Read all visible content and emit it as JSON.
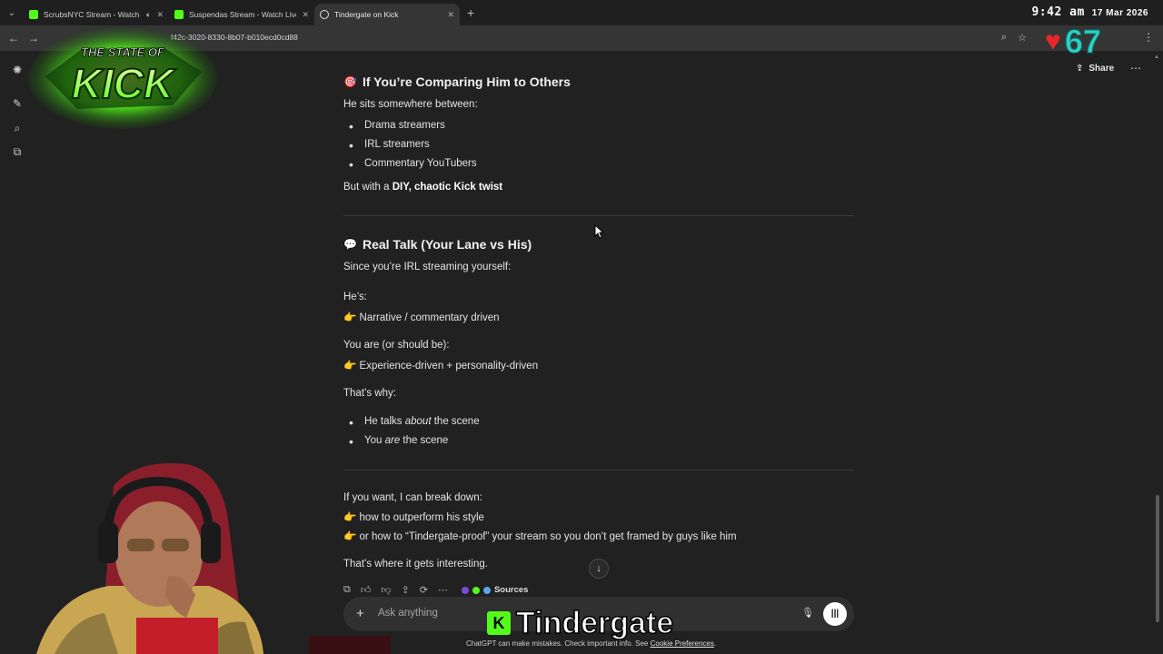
{
  "browser": {
    "tabs": [
      {
        "title": "ScrubsNYC Stream - Watch",
        "icon": "kick-icon"
      },
      {
        "title": "Suspendas Stream - Watch Live",
        "icon": "kick-icon"
      },
      {
        "title": "Tindergate on Kick",
        "icon": "chatgpt-icon"
      }
    ],
    "url": "f42c-3020-8330-8b07-b010ecd0cd88",
    "time": "9:42 am",
    "date": "17 Mar 2026"
  },
  "overlay": {
    "logo_line1": "THE STATE OF",
    "logo_line2": "KICK",
    "heart_count": "67",
    "banner_k": "K",
    "banner_text": "Tindergate"
  },
  "header": {
    "share_label": "Share"
  },
  "chat": {
    "section1": {
      "emoji": "🎯",
      "heading": "If You’re Comparing Him to Others",
      "intro": "He sits somewhere between:",
      "bullets": [
        "Drama streamers",
        "IRL streamers",
        "Commentary YouTubers"
      ],
      "outro_prefix": "But with a ",
      "outro_bold": "DIY, chaotic Kick twist"
    },
    "section2": {
      "emoji": "💬",
      "heading": "Real Talk (Your Lane vs His)",
      "intro": "Since you’re IRL streaming yourself:",
      "hes_label": "He’s:",
      "hes_value": "Narrative / commentary driven",
      "you_label": "You are (or should be):",
      "you_value": "Experience-driven + personality-driven",
      "why_label": "That’s why:",
      "bullet1_a": "He talks ",
      "bullet1_em": "about",
      "bullet1_b": " the scene",
      "bullet2_a": "You ",
      "bullet2_em": "are",
      "bullet2_b": " the scene"
    },
    "section3": {
      "intro": "If you want, I can break down:",
      "option1": "how to outperform his style",
      "option2": "or how to “Tindergate-proof” your stream so you don’t get framed by guys like him",
      "closing": "That’s where it gets interesting."
    },
    "pointer_emoji": "👉",
    "sources_label": "Sources"
  },
  "composer": {
    "placeholder": "Ask anything",
    "disclaimer": "ChatGPT can make mistakes. Check important info. See ",
    "disclaimer_link": "Cookie Preferences",
    "disclaimer_end": "."
  }
}
